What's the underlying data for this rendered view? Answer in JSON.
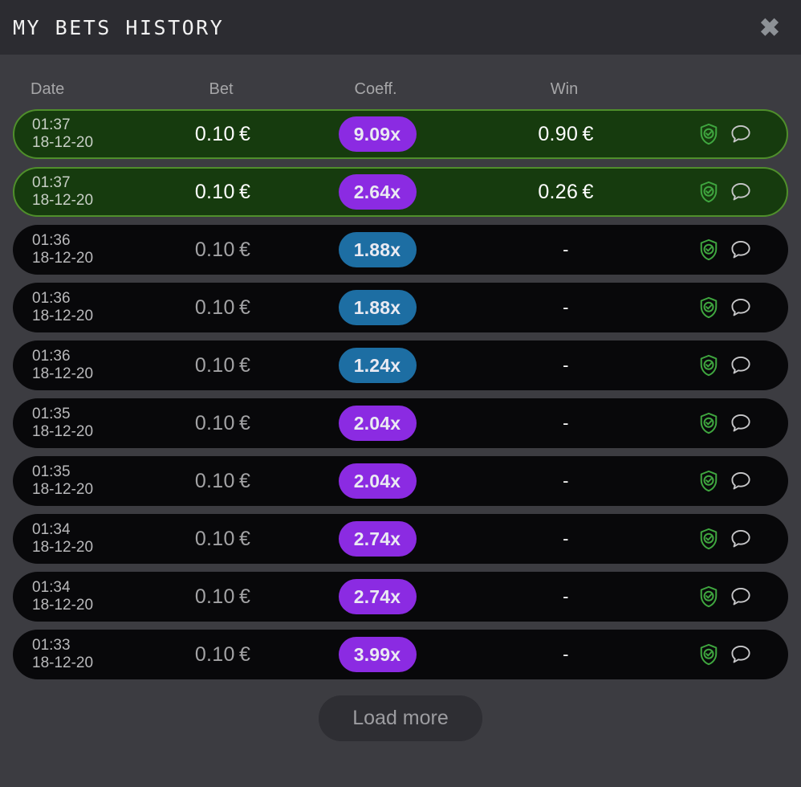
{
  "header": {
    "title": "MY BETS HISTORY",
    "close_label": "✖"
  },
  "table": {
    "columns": {
      "date": "Date",
      "bet": "Bet",
      "coeff": "Coeff.",
      "win": "Win"
    },
    "rows": [
      {
        "time": "01:37",
        "date": "18-12-20",
        "bet": "0.10 €",
        "coeff": "9.09x",
        "coeff_color": "purple",
        "win": "0.90 €",
        "won": true
      },
      {
        "time": "01:37",
        "date": "18-12-20",
        "bet": "0.10 €",
        "coeff": "2.64x",
        "coeff_color": "purple",
        "win": "0.26 €",
        "won": true
      },
      {
        "time": "01:36",
        "date": "18-12-20",
        "bet": "0.10 €",
        "coeff": "1.88x",
        "coeff_color": "blue",
        "win": "-",
        "won": false
      },
      {
        "time": "01:36",
        "date": "18-12-20",
        "bet": "0.10 €",
        "coeff": "1.88x",
        "coeff_color": "blue",
        "win": "-",
        "won": false
      },
      {
        "time": "01:36",
        "date": "18-12-20",
        "bet": "0.10 €",
        "coeff": "1.24x",
        "coeff_color": "blue",
        "win": "-",
        "won": false
      },
      {
        "time": "01:35",
        "date": "18-12-20",
        "bet": "0.10 €",
        "coeff": "2.04x",
        "coeff_color": "purple",
        "win": "-",
        "won": false
      },
      {
        "time": "01:35",
        "date": "18-12-20",
        "bet": "0.10 €",
        "coeff": "2.04x",
        "coeff_color": "purple",
        "win": "-",
        "won": false
      },
      {
        "time": "01:34",
        "date": "18-12-20",
        "bet": "0.10 €",
        "coeff": "2.74x",
        "coeff_color": "purple",
        "win": "-",
        "won": false
      },
      {
        "time": "01:34",
        "date": "18-12-20",
        "bet": "0.10 €",
        "coeff": "2.74x",
        "coeff_color": "purple",
        "win": "-",
        "won": false
      },
      {
        "time": "01:33",
        "date": "18-12-20",
        "bet": "0.10 €",
        "coeff": "3.99x",
        "coeff_color": "purple",
        "win": "-",
        "won": false
      }
    ],
    "row_icons": {
      "fairness": "shield-check-icon",
      "chat": "speech-bubble-icon"
    }
  },
  "footer": {
    "load_more_label": "Load more"
  },
  "colors": {
    "purple_badge": "#8b2be2",
    "blue_badge": "#1d6ea3",
    "win_row_bg": "#163b0e",
    "win_row_border": "#4f8f2b",
    "row_bg": "#08080a",
    "body_bg": "#3c3c41",
    "header_bg": "#2c2c31",
    "shield_green": "#3fa63f"
  }
}
